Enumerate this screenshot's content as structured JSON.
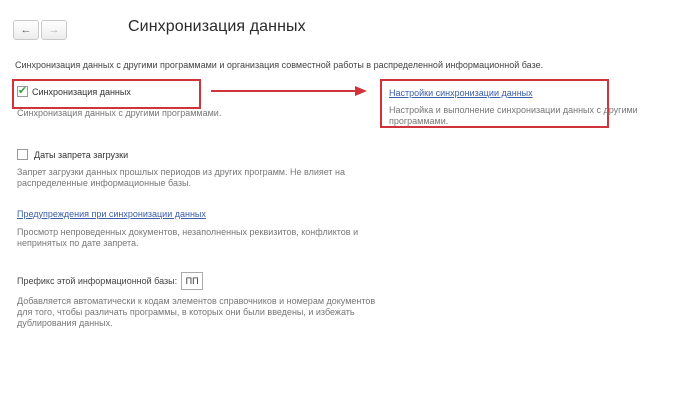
{
  "nav": {
    "back": "←",
    "forward": "→"
  },
  "page": {
    "title": "Синхронизация данных"
  },
  "intro": "Синхронизация данных с другими программами и организация совместной работы в распределенной информационной базе.",
  "sync": {
    "checkbox_label": "Синхронизация данных",
    "checked": true,
    "description": "Синхронизация данных с другими программами.",
    "settings_link": "Настройки синхронизации данных",
    "settings_description": "Настройка и выполнение синхронизации данных с другими программами."
  },
  "ban_dates": {
    "checkbox_label": "Даты запрета загрузки",
    "checked": false,
    "description": "Запрет загрузки данных прошлых периодов из других программ. Не влияет на распределенные информационные базы."
  },
  "warnings": {
    "link": "Предупреждения при синхронизации данных",
    "description": "Просмотр непроведенных документов, незаполненных реквизитов, конфликтов и непринятых по дате запрета."
  },
  "prefix": {
    "label": "Префикс этой информационной базы:",
    "value": "ПП",
    "description": "Добавляется автоматически к кодам элементов справочников и номерам документов для того, чтобы различать программы, в которых они были введены, и избежать дублирования данных."
  },
  "colors": {
    "highlight": "#d0333a",
    "link": "#3b5ea8",
    "check": "#38a238"
  }
}
